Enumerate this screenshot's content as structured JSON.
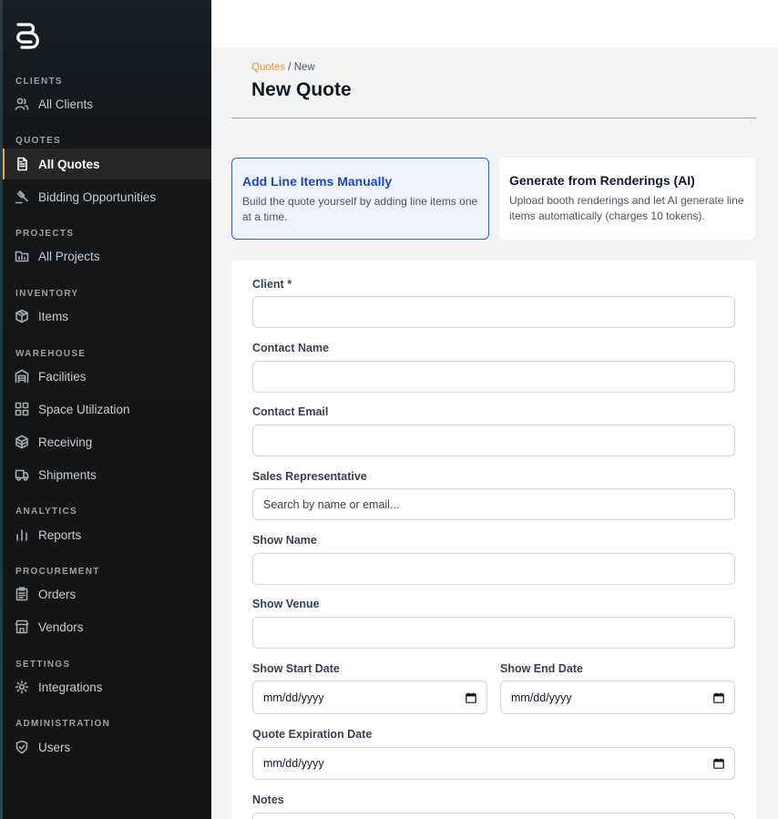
{
  "sidebar": {
    "sections": [
      {
        "label": "CLIENTS",
        "items": [
          {
            "label": "All Clients",
            "icon": "users-icon"
          }
        ]
      },
      {
        "label": "QUOTES",
        "items": [
          {
            "label": "All Quotes",
            "icon": "document-icon",
            "active": true
          },
          {
            "label": "Bidding Opportunities",
            "icon": "gavel-icon"
          }
        ]
      },
      {
        "label": "PROJECTS",
        "items": [
          {
            "label": "All Projects",
            "icon": "folder-chart-icon"
          }
        ]
      },
      {
        "label": "INVENTORY",
        "items": [
          {
            "label": "Items",
            "icon": "box-icon"
          }
        ]
      },
      {
        "label": "WAREHOUSE",
        "items": [
          {
            "label": "Facilities",
            "icon": "warehouse-icon"
          },
          {
            "label": "Space Utilization",
            "icon": "grid-icon"
          },
          {
            "label": "Receiving",
            "icon": "boxes-icon"
          },
          {
            "label": "Shipments",
            "icon": "truck-icon"
          }
        ]
      },
      {
        "label": "ANALYTICS",
        "items": [
          {
            "label": "Reports",
            "icon": "bar-chart-icon"
          }
        ]
      },
      {
        "label": "PROCUREMENT",
        "items": [
          {
            "label": "Orders",
            "icon": "clipboard-icon"
          },
          {
            "label": "Vendors",
            "icon": "store-icon"
          }
        ]
      },
      {
        "label": "SETTINGS",
        "items": [
          {
            "label": "Integrations",
            "icon": "gear-icon"
          }
        ]
      },
      {
        "label": "ADMINISTRATION",
        "items": [
          {
            "label": "Users",
            "icon": "shield-icon"
          }
        ]
      }
    ]
  },
  "breadcrumb": {
    "link": "Quotes",
    "separator": "/",
    "current": "New"
  },
  "page": {
    "title": "New Quote"
  },
  "modes": [
    {
      "title": "Add Line Items Manually",
      "desc": "Build the quote yourself by adding line items one at a time.",
      "selected": true
    },
    {
      "title": "Generate from Renderings (AI)",
      "desc": "Upload booth renderings and let AI generate line items automatically (charges 10 tokens).",
      "selected": false
    }
  ],
  "form": {
    "client": {
      "label": "Client *",
      "value": ""
    },
    "contact_name": {
      "label": "Contact Name",
      "value": ""
    },
    "contact_email": {
      "label": "Contact Email",
      "value": ""
    },
    "sales_rep": {
      "label": "Sales Representative",
      "placeholder": "Search by name or email..."
    },
    "show_name": {
      "label": "Show Name",
      "value": ""
    },
    "show_venue": {
      "label": "Show Venue",
      "value": ""
    },
    "show_start": {
      "label": "Show Start Date",
      "placeholder": "mm/dd/yyyy"
    },
    "show_end": {
      "label": "Show End Date",
      "placeholder": "mm/dd/yyyy"
    },
    "quote_expiration": {
      "label": "Quote Expiration Date",
      "placeholder": "mm/dd/yyyy"
    },
    "notes": {
      "label": "Notes"
    }
  }
}
